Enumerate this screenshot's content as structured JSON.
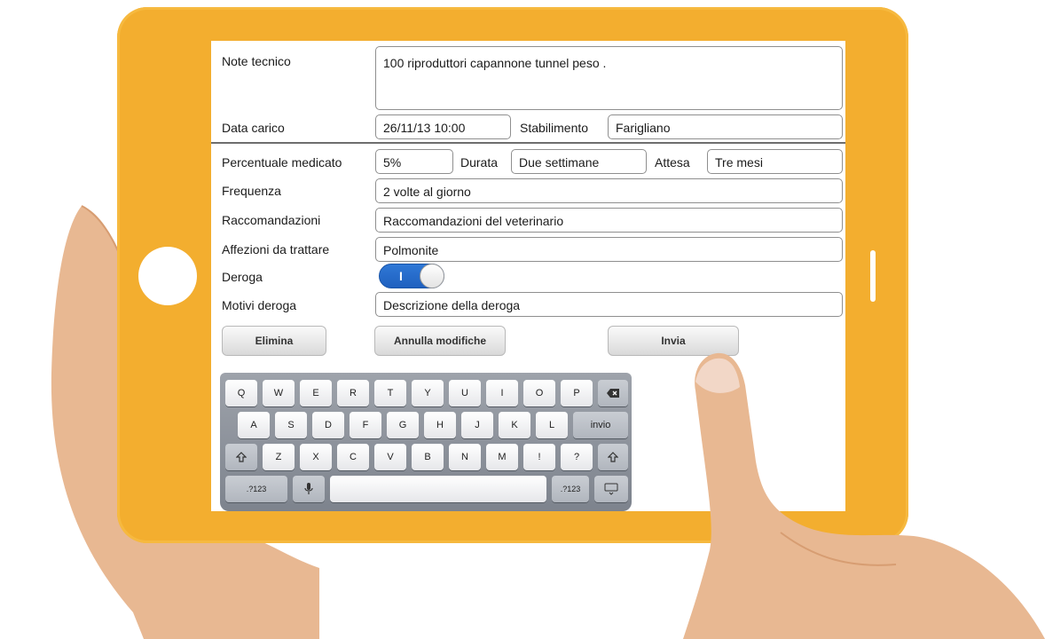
{
  "form": {
    "note_label": "Note tecnico",
    "note_value": "100 riproduttori capannone tunnel peso .",
    "data_label": "Data carico",
    "data_value": "26/11/13 10:00",
    "stab_label": "Stabilimento",
    "stab_value": "Farigliano",
    "perc_label": "Percentuale medicato",
    "perc_value": "5%",
    "durata_label": "Durata",
    "durata_value": "Due settimane",
    "attesa_label": "Attesa",
    "attesa_value": "Tre mesi",
    "freq_label": "Frequenza",
    "freq_value": "2 volte al giorno",
    "racc_label": "Raccomandazioni",
    "racc_value": "Raccomandazioni del veterinario",
    "aff_label": "Affezioni da trattare",
    "aff_value": "Polmonite",
    "deroga_label": "Deroga",
    "deroga_mark": "I",
    "motivi_label": "Motivi deroga",
    "motivi_value": "Descrizione della deroga"
  },
  "buttons": {
    "elimina": "Elimina",
    "annulla": "Annulla modifiche",
    "invia": "Invia"
  },
  "keyboard": {
    "row1": [
      "Q",
      "W",
      "E",
      "R",
      "T",
      "Y",
      "U",
      "I",
      "O",
      "P"
    ],
    "row2": [
      "A",
      "S",
      "D",
      "F",
      "G",
      "H",
      "J",
      "K",
      "L"
    ],
    "row2_enter": "invio",
    "row3": [
      "Z",
      "X",
      "C",
      "V",
      "B",
      "N",
      "M"
    ],
    "row3_punct": [
      "!",
      "?"
    ],
    "num_left": ".?123",
    "num_right": ".?123"
  },
  "colors": {
    "tablet_frame": "#f3ae2f",
    "toggle_on": "#2f78d6",
    "skin": "#e8b892"
  }
}
